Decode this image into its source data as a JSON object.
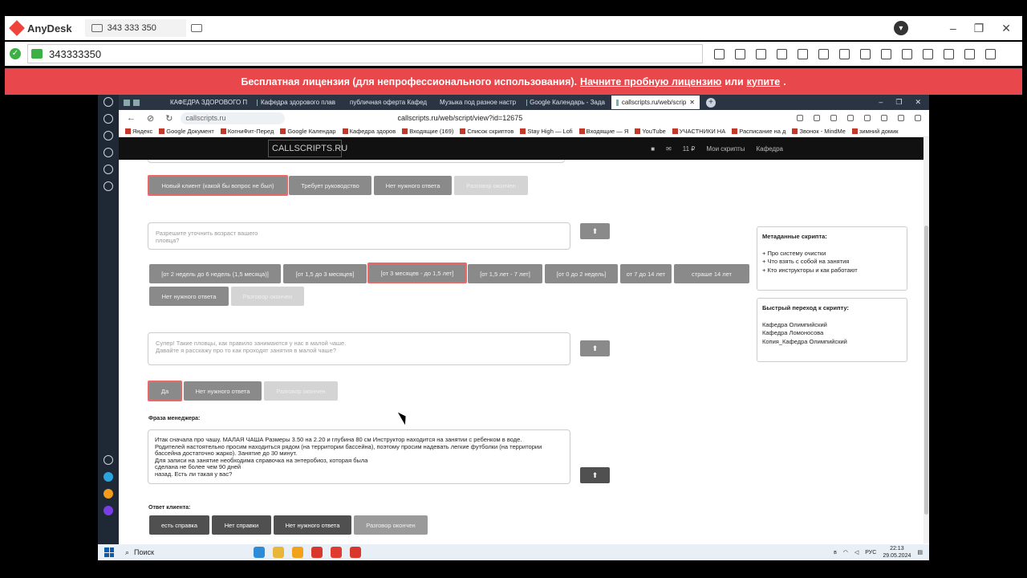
{
  "anydesk": {
    "app_name": "AnyDesk",
    "tab_id": "343 333 350",
    "address": "343333350",
    "license": {
      "text1": "Бесплатная лицензия (для непрофессионального использования).",
      "link1": "Начните пробную лицензию",
      "text2": "или",
      "link2": "купите",
      "text3": "."
    }
  },
  "browser": {
    "tabs": [
      {
        "label": "КАФЕДРА ЗДОРОВОГО П"
      },
      {
        "label": "Кафедра здорового плав"
      },
      {
        "label": "публичная оферта Кафед"
      },
      {
        "label": "Музыка под разное настр"
      },
      {
        "label": "Google Календарь - Зада"
      },
      {
        "label": "callscripts.ru/web/scrip"
      }
    ],
    "url": "callscripts.ru",
    "page_title": "callscripts.ru/web/script/view?id=12675",
    "bookmarks": [
      "Яндекс",
      "Google Документ",
      "КогниФит-Перед",
      "Google Календар",
      "Кафедра здоров",
      "Входящие (169)",
      "Список скриптов",
      "Stay High — Lofi",
      "Входящие — Я",
      "YouTube",
      "УЧАСТНИКИ НА",
      "Расписание на д",
      "Звонок - MindMe",
      "зимний домик"
    ]
  },
  "site": {
    "logo": "CALLSCRIPTS.RU",
    "count": "11 ₽",
    "nav1": "Мои скрипты",
    "nav2": "Кафедра"
  },
  "script": {
    "row1": [
      "Новый клиент (какой бы вопрос не был)",
      "Требует руководство",
      "Нет нужного ответа",
      "Разговор окончен"
    ],
    "q1": "Разрешите уточнить возраст вашего\nпловца?",
    "row2": [
      "[от 2 недель до 6 недель (1,5 месяца)]",
      "[от 1,5 до 3 месяцев]",
      "[от 3 месяцев - до 1,5 лет]",
      "[от 1,5 лет - 7 лет]",
      "[от 0 до 2 недель]",
      "от 7 до 14 лет",
      "страше 14 лет"
    ],
    "row2b": [
      "Нет нужного ответа",
      "Разговор окончен"
    ],
    "q2": "Супер! Такие пловцы, как правило занимаются у нас в малой чаше.\nДавайте я расскажу про то как проходят занятия в малой чаше?",
    "row3": [
      "Да",
      "Нет нужного ответа",
      "Разговор окончен"
    ],
    "manager_label": "Фраза менеджера:",
    "manager_text": "Итак сначала про чашу. МАЛАЯ ЧАША Размеры 3.50 на 2.20 и глубина 80 см Инструктор находится на занятии с ребенком в воде.\nРодителей настоятельно просим находиться рядом (на территории бассейна), поэтому просим надевать легкие футболки (на территории\nбассейна достаточно жарко). Занятие до 30 минут.\nДля записи на занятие необходима справочка на энтеробиоз, которая была\nсделана не более чем 90 дней\nназад. Есть ли такая у вас?",
    "client_label": "Ответ клиента:",
    "row4": [
      "есть справка",
      "Нет справки",
      "Нет нужного ответа",
      "Разговор окончен"
    ],
    "up_arrow": "⬆"
  },
  "meta": {
    "title": "Метаданные скрипта:",
    "items": [
      "+ Про систему очистки",
      "+ Что взять с собой на занятия",
      "+ Кто инструкторы и как работают"
    ]
  },
  "quick": {
    "title": "Быстрый переход к скрипту:",
    "items": [
      "Кафедра Олимпийский",
      "Кафедра Ломоносова",
      "Копия_Кафедра Олимпийский"
    ]
  },
  "taskbar": {
    "search": "Поиск",
    "lang": "РУС",
    "time": "22:13",
    "date": "29.05.2024"
  },
  "colors": {
    "license_bar": "#e8474b",
    "button_gray": "#8a8a8a",
    "button_dark": "#505050",
    "selected_border": "#e66666"
  }
}
